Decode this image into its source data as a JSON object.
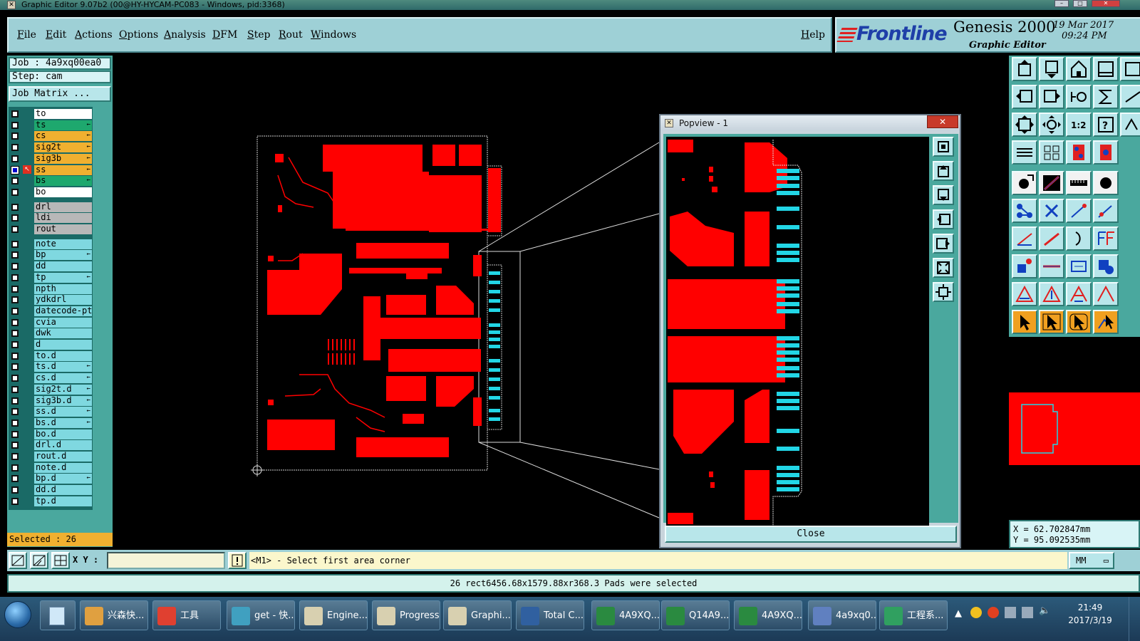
{
  "window": {
    "title": "Graphic Editor 9.07b2 (00@HY-HYCAM-PC083 - Windows, pid:3368)"
  },
  "menu": {
    "items": [
      "File",
      "Edit",
      "Actions",
      "Options",
      "Analysis",
      "DFM",
      "Step",
      "Rout",
      "Windows"
    ],
    "help": "Help"
  },
  "brand": {
    "logo": "Frontline",
    "product": "Genesis 2000",
    "subtitle": "Graphic Editor",
    "date": "19 Mar 2017",
    "time": "09:24 PM"
  },
  "left_panel": {
    "job": "Job : 4a9xq00ea0",
    "step": "Step: cam",
    "job_matrix": "Job Matrix ...",
    "selected": "Selected : 26",
    "layers": [
      {
        "name": "to",
        "color": "#ffffff",
        "checked": false,
        "mark": ""
      },
      {
        "name": "ts",
        "color": "#1ea86e",
        "checked": false,
        "mark": "←"
      },
      {
        "name": "cs",
        "color": "#f0b030",
        "checked": false,
        "mark": "←"
      },
      {
        "name": "sig2t",
        "color": "#f0b030",
        "checked": false,
        "mark": "←"
      },
      {
        "name": "sig3b",
        "color": "#f0b030",
        "checked": false,
        "mark": "←"
      },
      {
        "name": "ss",
        "color": "#f0b030",
        "checked": true,
        "mark": "←"
      },
      {
        "name": "bs",
        "color": "#1ea86e",
        "checked": false,
        "mark": "←"
      },
      {
        "name": "bo",
        "color": "#ffffff",
        "checked": false,
        "mark": ""
      },
      {
        "name": "drl",
        "color": "#b8b8b8",
        "checked": false,
        "mark": ""
      },
      {
        "name": "ldi",
        "color": "#b8b8b8",
        "checked": false,
        "mark": ""
      },
      {
        "name": "rout",
        "color": "#b8b8b8",
        "checked": false,
        "mark": ""
      },
      {
        "name": "note",
        "color": "#7fd8e0",
        "checked": false,
        "mark": ""
      },
      {
        "name": "bp",
        "color": "#7fd8e0",
        "checked": false,
        "mark": "←"
      },
      {
        "name": "dd",
        "color": "#7fd8e0",
        "checked": false,
        "mark": ""
      },
      {
        "name": "tp",
        "color": "#7fd8e0",
        "checked": false,
        "mark": "←"
      },
      {
        "name": "npth",
        "color": "#7fd8e0",
        "checked": false,
        "mark": ""
      },
      {
        "name": "ydkdrl",
        "color": "#7fd8e0",
        "checked": false,
        "mark": ""
      },
      {
        "name": "datecode-ptr",
        "color": "#7fd8e0",
        "checked": false,
        "mark": ""
      },
      {
        "name": "cvia",
        "color": "#7fd8e0",
        "checked": false,
        "mark": ""
      },
      {
        "name": "dwk",
        "color": "#7fd8e0",
        "checked": false,
        "mark": ""
      },
      {
        "name": "d",
        "color": "#7fd8e0",
        "checked": false,
        "mark": ""
      },
      {
        "name": "to.d",
        "color": "#7fd8e0",
        "checked": false,
        "mark": ""
      },
      {
        "name": "ts.d",
        "color": "#7fd8e0",
        "checked": false,
        "mark": "←"
      },
      {
        "name": "cs.d",
        "color": "#7fd8e0",
        "checked": false,
        "mark": "←"
      },
      {
        "name": "sig2t.d",
        "color": "#7fd8e0",
        "checked": false,
        "mark": "←"
      },
      {
        "name": "sig3b.d",
        "color": "#7fd8e0",
        "checked": false,
        "mark": "←"
      },
      {
        "name": "ss.d",
        "color": "#7fd8e0",
        "checked": false,
        "mark": "←"
      },
      {
        "name": "bs.d",
        "color": "#7fd8e0",
        "checked": false,
        "mark": "←"
      },
      {
        "name": "bo.d",
        "color": "#7fd8e0",
        "checked": false,
        "mark": ""
      },
      {
        "name": "drl.d",
        "color": "#7fd8e0",
        "checked": false,
        "mark": ""
      },
      {
        "name": "rout.d",
        "color": "#7fd8e0",
        "checked": false,
        "mark": ""
      },
      {
        "name": "note.d",
        "color": "#7fd8e0",
        "checked": false,
        "mark": ""
      },
      {
        "name": "bp.d",
        "color": "#7fd8e0",
        "checked": false,
        "mark": "←"
      },
      {
        "name": "dd.d",
        "color": "#7fd8e0",
        "checked": false,
        "mark": ""
      },
      {
        "name": "tp.d",
        "color": "#7fd8e0",
        "checked": false,
        "mark": ""
      }
    ]
  },
  "popview": {
    "title": "Popview - 1",
    "close_label": "Close"
  },
  "coords": {
    "x": "X  =  62.702847mm",
    "y": "Y  =  95.092535mm"
  },
  "command": {
    "xy_label": "X Y :",
    "xy_value": "",
    "prompt": "<M1> - Select first area corner",
    "unit": "MM"
  },
  "status": {
    "message": "26 rect6456.68x1579.88xr368.3 Pads were selected"
  },
  "taskbar": {
    "items": [
      {
        "label": "兴森快...",
        "icon": "shell-icon"
      },
      {
        "label": "工具",
        "icon": "tiles-icon"
      },
      {
        "label": "get - 快...",
        "icon": "eye-icon"
      },
      {
        "label": "Engine...",
        "icon": "x-window-icon"
      },
      {
        "label": "Progress",
        "icon": "x-window-icon"
      },
      {
        "label": "Graphi...",
        "icon": "x-window-icon"
      },
      {
        "label": "Total C...",
        "icon": "floppy-icon"
      },
      {
        "label": "4A9XQ...",
        "icon": "excel-icon"
      },
      {
        "label": "Q14A9...",
        "icon": "excel-icon"
      },
      {
        "label": "4A9XQ...",
        "icon": "excel-icon"
      },
      {
        "label": "4a9xq0...",
        "icon": "editor-icon"
      },
      {
        "label": "工程系...",
        "icon": "app-f-icon"
      }
    ],
    "time": "21:49",
    "date": "2017/3/19"
  }
}
